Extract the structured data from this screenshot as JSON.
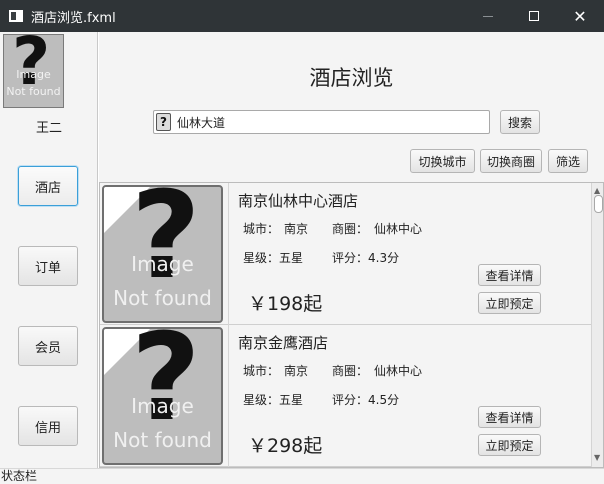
{
  "window": {
    "title": "酒店浏览.fxml"
  },
  "sidebar": {
    "avatar_text_1": "Image",
    "avatar_text_2": "Not found",
    "username": "王二",
    "items": [
      {
        "label": "酒店"
      },
      {
        "label": "订单"
      },
      {
        "label": "会员"
      },
      {
        "label": "信用"
      }
    ]
  },
  "main": {
    "title": "酒店浏览",
    "search": {
      "value": "仙林大道",
      "button": "搜索"
    },
    "filters": {
      "switch_city": "切换城市",
      "switch_district": "切换商圈",
      "filter": "筛选"
    }
  },
  "hotels": [
    {
      "name": "南京仙林中心酒店",
      "city_label": "城市：",
      "city": "南京",
      "district_label": "商圈：",
      "district": "仙林中心",
      "star": "星级：五星",
      "rating": "评分：4.3分",
      "price": "￥198起",
      "detail_button": "查看详情",
      "book_button": "立即预定",
      "image_text_1": "Image",
      "image_text_2": "Not found"
    },
    {
      "name": "南京金鹰酒店",
      "city_label": "城市：",
      "city": "南京",
      "district_label": "商圈：",
      "district": "仙林中心",
      "star": "星级：五星",
      "rating": "评分：4.5分",
      "price": "￥298起",
      "detail_button": "查看详情",
      "book_button": "立即预定",
      "image_text_1": "Image",
      "image_text_2": "Not found"
    }
  ],
  "statusbar": {
    "text": "状态栏"
  }
}
